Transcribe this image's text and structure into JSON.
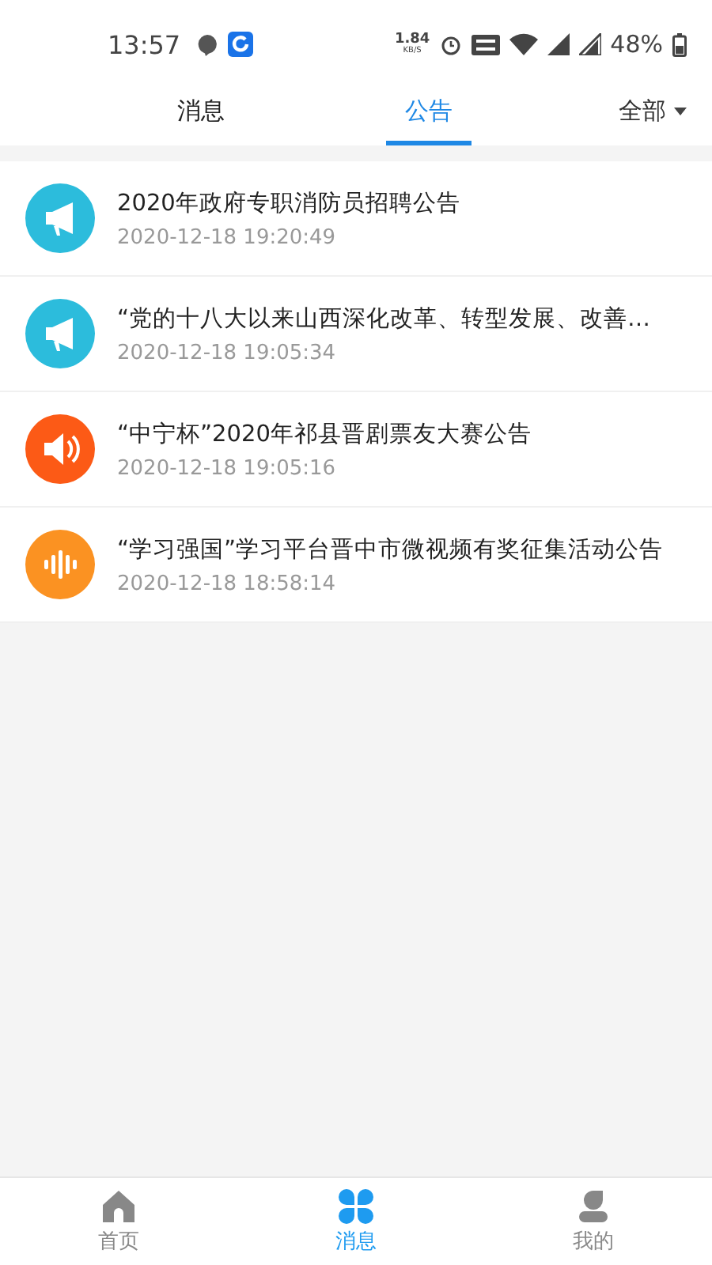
{
  "status_bar": {
    "time": "13:57",
    "speed": "1.84",
    "speed_unit": "KB/S",
    "battery": "48%"
  },
  "tabs": [
    {
      "label": "消息",
      "selected": false
    },
    {
      "label": "公告",
      "selected": true
    }
  ],
  "filter": {
    "label": "全部"
  },
  "notices": [
    {
      "kind": "megaphone",
      "color": "#2cbcdc",
      "title": "2020年政府专职消防员招聘公告",
      "time": "2020-12-18 19:20:49"
    },
    {
      "kind": "megaphone",
      "color": "#2cbcdc",
      "title": "“党的十八大以来山西深化改革、转型发展、改善…",
      "time": "2020-12-18 19:05:34"
    },
    {
      "kind": "speaker",
      "color": "#fc5a16",
      "title": "“中宁杯”2020年祁县晋剧票友大赛公告",
      "time": "2020-12-18 19:05:16"
    },
    {
      "kind": "waveform",
      "color": "#fb9222",
      "title": "“学习强国”学习平台晋中市微视频有奖征集活动公告",
      "time": "2020-12-18 18:58:14"
    }
  ],
  "bottom_nav": [
    {
      "kind": "home",
      "label": "首页",
      "selected": false
    },
    {
      "kind": "clover",
      "label": "消息",
      "selected": true
    },
    {
      "kind": "person",
      "label": "我的",
      "selected": false
    }
  ]
}
